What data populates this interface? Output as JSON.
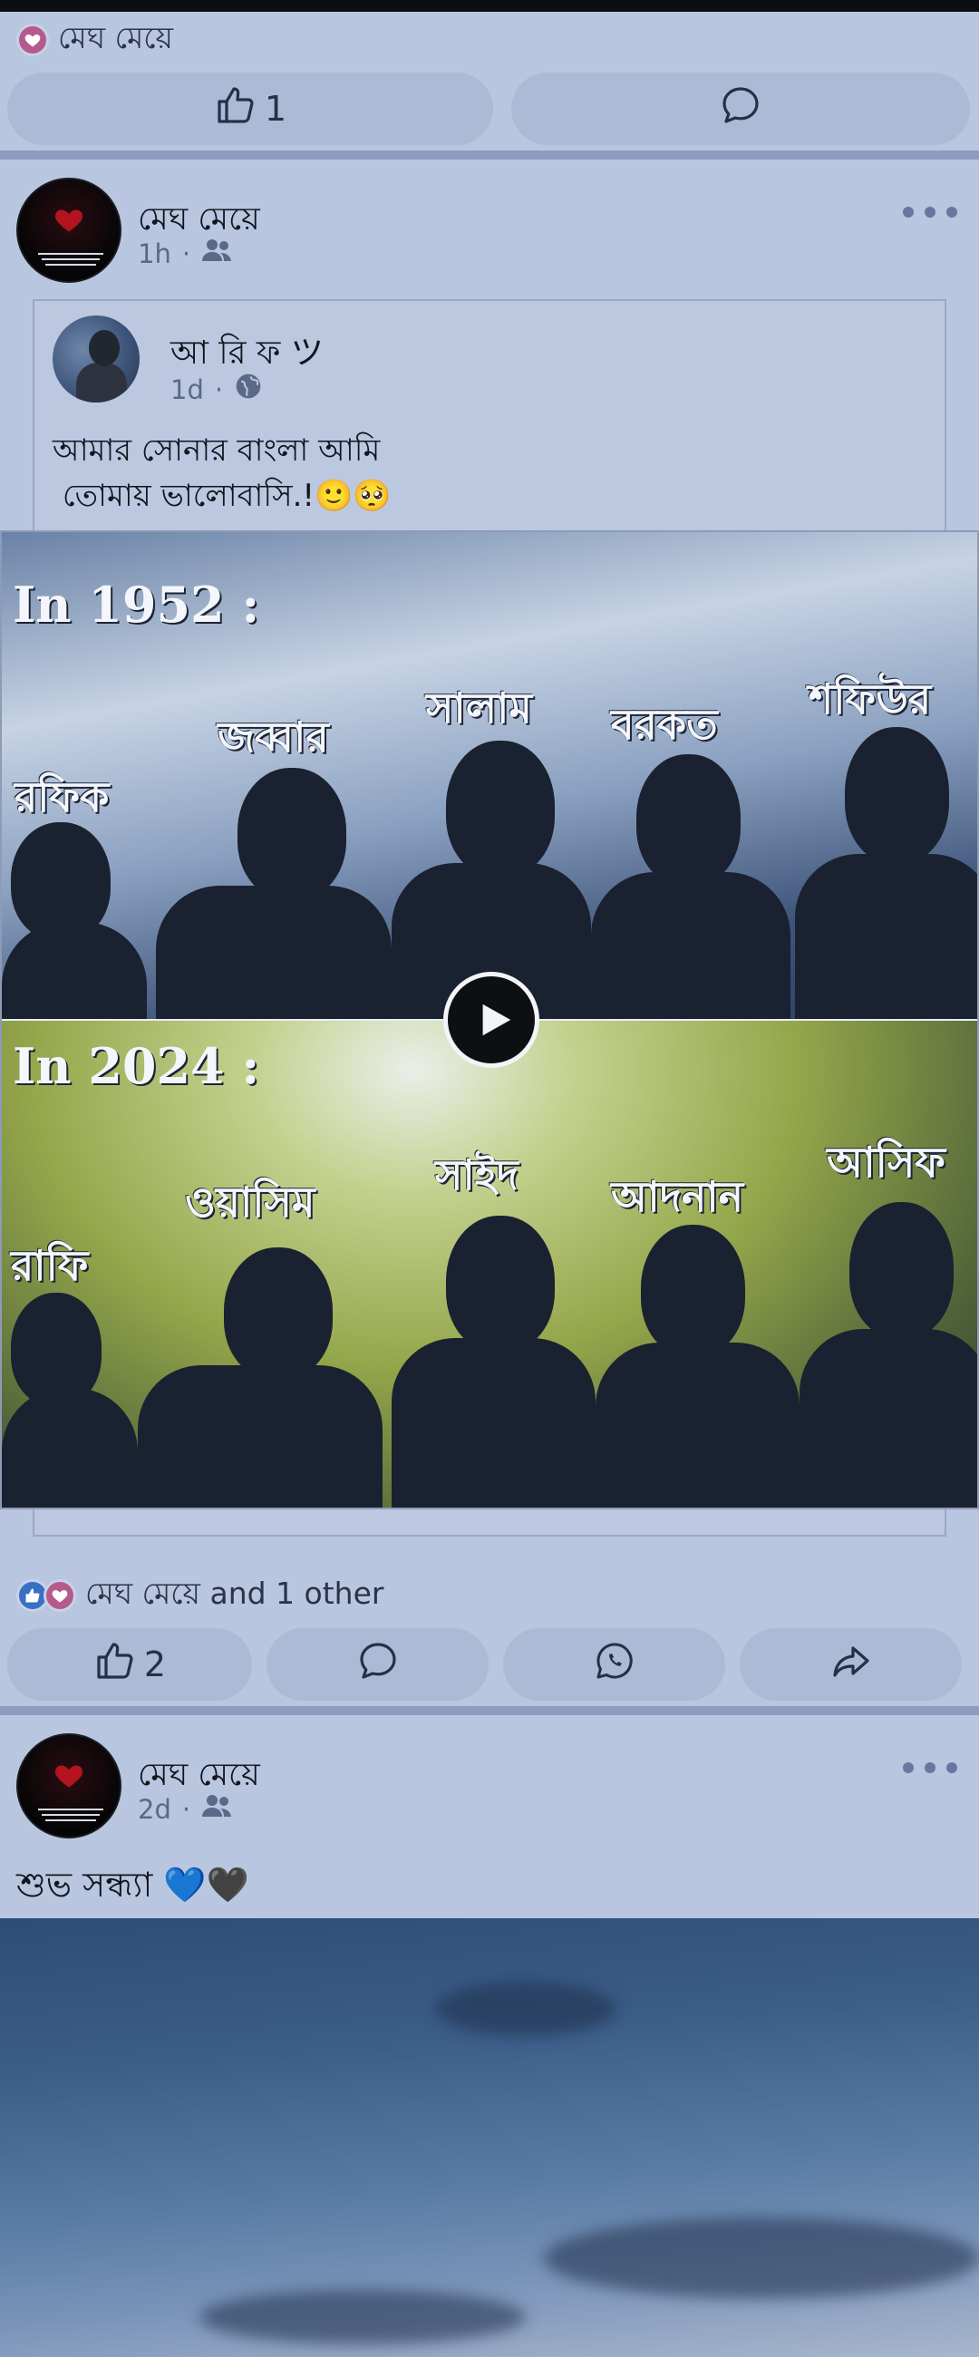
{
  "top_post": {
    "reacted_name": "মেঘ মেয়ে",
    "like_count": "1"
  },
  "post1": {
    "poster_name": "মেঘ মেয়ে",
    "time": "1h",
    "audience_icon": "friends-icon",
    "shared": {
      "author": "আ রি ফ ツ",
      "time": "1d",
      "audience_icon": "globe-icon",
      "text": "আমার সোনার বাংলা আমি\n তোমায় ভালোবাসি.!🙂🥺"
    },
    "video": {
      "top_year": "In 1952 :",
      "top_names": [
        "রফিক",
        "জব্বার",
        "সালাম",
        "বরকত",
        "শফিউর"
      ],
      "bottom_year": "In 2024 :",
      "bottom_names": [
        "রাফি",
        "ওয়াসিম",
        "সাইদ",
        "আদনান",
        "আসিফ"
      ]
    },
    "reaction_summary": "মেঘ মেয়ে and 1 other",
    "like_count": "2"
  },
  "post2": {
    "poster_name": "মেঘ মেয়ে",
    "time": "2d",
    "audience_icon": "friends-icon",
    "text": "শুভ সন্ধ্যা 💙🖤"
  },
  "colors": {
    "background": "#b9c6df",
    "pill": "#acbad6",
    "divider": "#8c9dc0",
    "meta_text": "#5a6988",
    "like_badge": "#3a6fc4",
    "love_badge": "#b65a8e"
  }
}
